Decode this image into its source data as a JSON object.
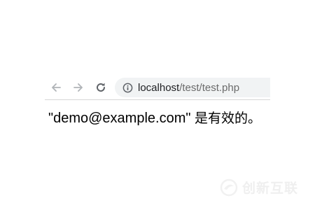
{
  "browser": {
    "back_icon": "arrow-left-icon",
    "forward_icon": "arrow-right-icon",
    "reload_icon": "reload-icon",
    "site_info_icon": "info-icon",
    "url_host": "localhost",
    "url_path": "/test/test.php"
  },
  "content": {
    "output_text": "\"demo@example.com\" ",
    "output_suffix": "是有效的。"
  },
  "watermark": {
    "brand_text": "创新互联"
  },
  "colors": {
    "nav_icon_disabled": "#9aa0a6",
    "nav_icon_active": "#5f6368",
    "omnibox_bg": "#f1f3f4"
  }
}
